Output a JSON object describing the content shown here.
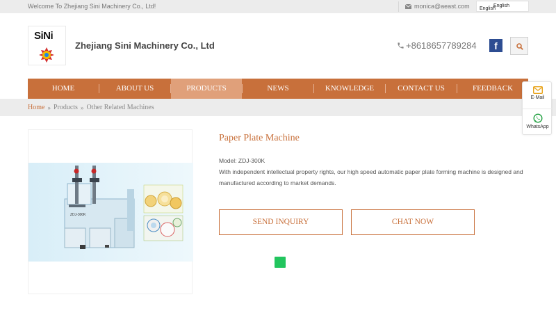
{
  "topbar": {
    "welcome": "Welcome To Zhejiang Sini Machinery Co., Ltd!",
    "email": "monica@aeast.com",
    "language_current": "English",
    "language_option": "English"
  },
  "header": {
    "logo_text": "SiNi",
    "company_name": "Zhejiang Sini Machinery Co., Ltd",
    "phone": "+8618657789284",
    "social_icon": "facebook-icon",
    "search_icon": "search-icon"
  },
  "nav": {
    "items": [
      {
        "label": "HOME"
      },
      {
        "label": "ABOUT US"
      },
      {
        "label": "PRODUCTS"
      },
      {
        "label": "NEWS"
      },
      {
        "label": "KNOWLEDGE"
      },
      {
        "label": "CONTACT US"
      },
      {
        "label": "FEEDBACK"
      }
    ],
    "active_index": 2
  },
  "breadcrumb": {
    "items": [
      "Home",
      "Products",
      "Other Related Machines"
    ]
  },
  "product": {
    "title": "Paper Plate Machine",
    "model": "Model: ZDJ-300K",
    "description": "With independent intellectual property rights, our high speed automatic paper plate forming machine is designed and manufactured according to market demands.",
    "inquiry_label": "SEND INQUIRY",
    "chat_label": "CHAT NOW",
    "machine_label": "ZDJ-300K"
  },
  "floating_contact": {
    "email_label": "E-Mail",
    "whatsapp_label": "WhatsApp"
  },
  "colors": {
    "accent": "#c8703b",
    "nav_active": "#e0a07a",
    "facebook": "#2d4d92",
    "whatsapp": "#25a244",
    "mail": "#e8a31a"
  }
}
